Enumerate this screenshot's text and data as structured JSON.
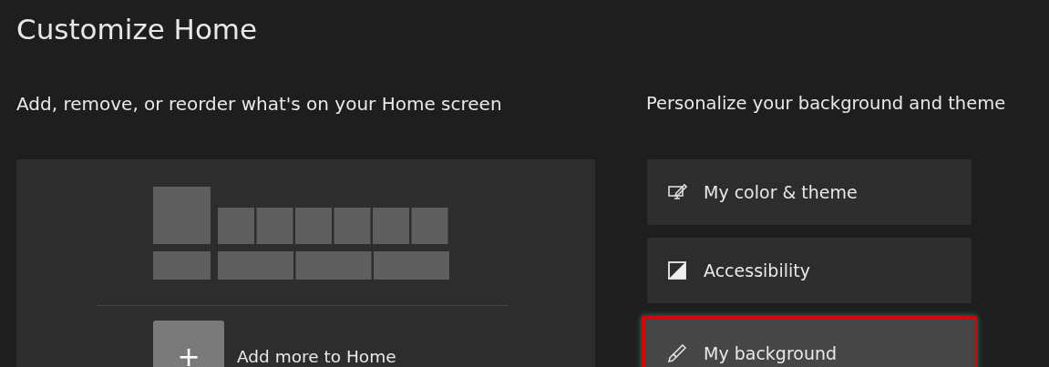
{
  "title": "Customize Home",
  "home_section": {
    "heading": "Add, remove, or reorder what's on your Home screen",
    "add_button": {
      "symbol": "+",
      "label": "Add more to Home"
    }
  },
  "personalize_section": {
    "heading": "Personalize your background and theme",
    "items": [
      {
        "kind": "theme",
        "label": "My color & theme",
        "selected": false
      },
      {
        "kind": "contrast",
        "label": "Accessibility",
        "selected": false
      },
      {
        "kind": "brush",
        "label": "My background",
        "selected": true
      }
    ]
  }
}
